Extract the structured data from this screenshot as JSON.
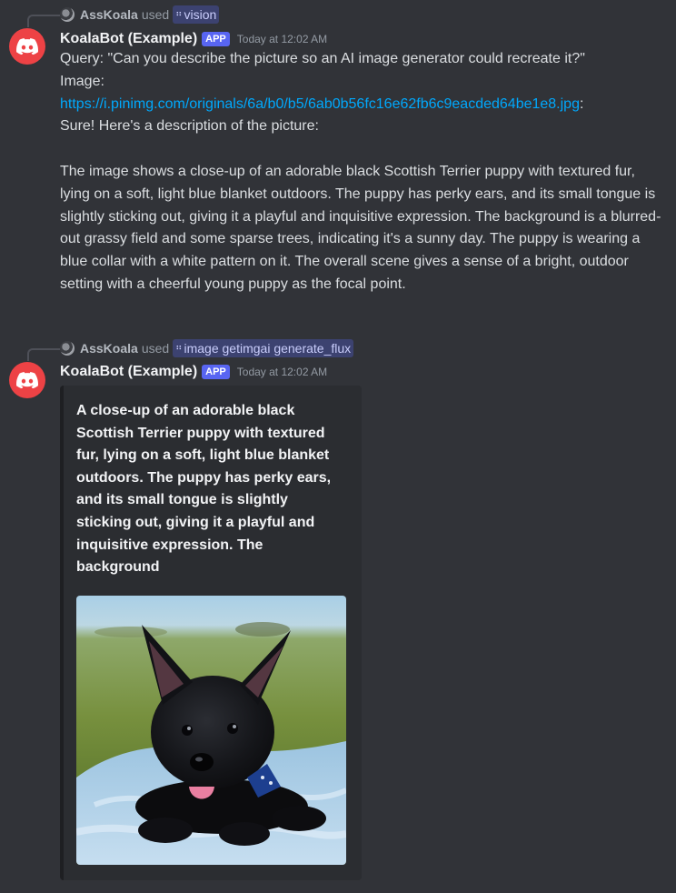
{
  "messages": [
    {
      "reply": {
        "user": "AssKoala",
        "used": "used",
        "command": "vision"
      },
      "author": "KoalaBot (Example)",
      "app_tag": "APP",
      "timestamp": "Today at 12:02 AM",
      "query_line": "Query: \"Can you describe the picture so an AI image generator could recreate it?\"",
      "image_label": "Image:",
      "image_url": "https://i.pinimg.com/originals/6a/b0/b5/6ab0b56fc16e62fb6c9eacded64be1e8.jpg",
      "url_suffix": ":",
      "intro": "Sure! Here's a description of the picture:",
      "description": "The image shows a close-up of an adorable black Scottish Terrier puppy with textured fur, lying on a soft, light blue blanket outdoors. The puppy has perky ears, and its small tongue is slightly sticking out, giving it a playful and inquisitive expression. The background is a blurred-out grassy field and some sparse trees, indicating it's a sunny day. The puppy is wearing a blue collar with a white pattern on it. The overall scene gives a sense of a bright, outdoor setting with a cheerful young puppy as the focal point."
    },
    {
      "reply": {
        "user": "AssKoala",
        "used": "used",
        "command": "image getimgai generate_flux"
      },
      "author": "KoalaBot (Example)",
      "app_tag": "APP",
      "timestamp": "Today at 12:02 AM",
      "embed": {
        "title": "A close-up of an adorable black Scottish Terrier puppy with textured fur, lying on a soft, light blue blanket outdoors. The puppy has perky ears, and its small tongue is slightly sticking out, giving it a playful and inquisitive expression. The background",
        "image_icon": "generated-puppy-image"
      }
    }
  ],
  "icons": {
    "bot_avatar": "discord-logo-icon",
    "command": "slash-command-icon"
  },
  "colors": {
    "background": "#313338",
    "avatar": "#ed4245",
    "app_tag": "#5865f2",
    "link": "#00a8fc",
    "embed_bg": "#2b2d31"
  }
}
